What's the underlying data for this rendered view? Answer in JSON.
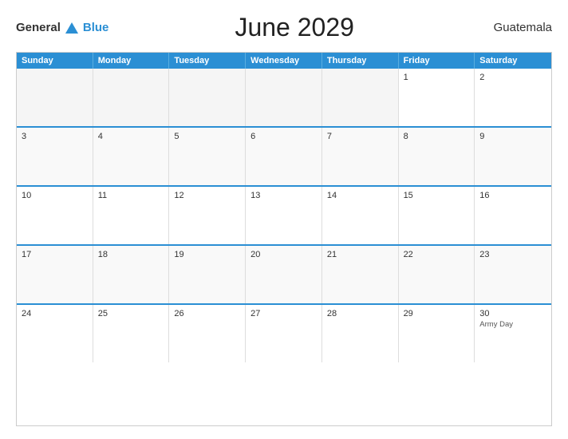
{
  "logo": {
    "general": "General",
    "blue": "Blue"
  },
  "title": "June 2029",
  "country": "Guatemala",
  "days_header": [
    "Sunday",
    "Monday",
    "Tuesday",
    "Wednesday",
    "Thursday",
    "Friday",
    "Saturday"
  ],
  "weeks": [
    [
      {
        "day": "",
        "empty": true
      },
      {
        "day": "",
        "empty": true
      },
      {
        "day": "",
        "empty": true
      },
      {
        "day": "",
        "empty": true
      },
      {
        "day": "",
        "empty": true
      },
      {
        "day": "1",
        "holiday": ""
      },
      {
        "day": "2",
        "holiday": ""
      }
    ],
    [
      {
        "day": "3",
        "holiday": ""
      },
      {
        "day": "4",
        "holiday": ""
      },
      {
        "day": "5",
        "holiday": ""
      },
      {
        "day": "6",
        "holiday": ""
      },
      {
        "day": "7",
        "holiday": ""
      },
      {
        "day": "8",
        "holiday": ""
      },
      {
        "day": "9",
        "holiday": ""
      }
    ],
    [
      {
        "day": "10",
        "holiday": ""
      },
      {
        "day": "11",
        "holiday": ""
      },
      {
        "day": "12",
        "holiday": ""
      },
      {
        "day": "13",
        "holiday": ""
      },
      {
        "day": "14",
        "holiday": ""
      },
      {
        "day": "15",
        "holiday": ""
      },
      {
        "day": "16",
        "holiday": ""
      }
    ],
    [
      {
        "day": "17",
        "holiday": ""
      },
      {
        "day": "18",
        "holiday": ""
      },
      {
        "day": "19",
        "holiday": ""
      },
      {
        "day": "20",
        "holiday": ""
      },
      {
        "day": "21",
        "holiday": ""
      },
      {
        "day": "22",
        "holiday": ""
      },
      {
        "day": "23",
        "holiday": ""
      }
    ],
    [
      {
        "day": "24",
        "holiday": ""
      },
      {
        "day": "25",
        "holiday": ""
      },
      {
        "day": "26",
        "holiday": ""
      },
      {
        "day": "27",
        "holiday": ""
      },
      {
        "day": "28",
        "holiday": ""
      },
      {
        "day": "29",
        "holiday": ""
      },
      {
        "day": "30",
        "holiday": "Army Day"
      }
    ]
  ]
}
